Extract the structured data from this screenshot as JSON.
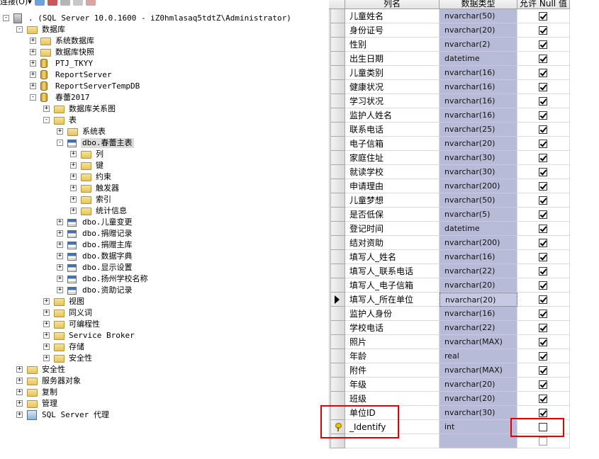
{
  "toolbar": {
    "connect_label": "连接(O)▾"
  },
  "tree": [
    {
      "level": 0,
      "expander": "-",
      "icon": "server",
      "label": ". (SQL Server 10.0.1600 - iZ0hmlasaq5tdtZ\\Administrator)"
    },
    {
      "level": 1,
      "expander": "-",
      "icon": "folder",
      "label": "数据库"
    },
    {
      "level": 2,
      "expander": "+",
      "icon": "folder",
      "label": "系统数据库"
    },
    {
      "level": 2,
      "expander": "+",
      "icon": "folder",
      "label": "数据库快照"
    },
    {
      "level": 2,
      "expander": "+",
      "icon": "db",
      "label": "PTJ_TKYY"
    },
    {
      "level": 2,
      "expander": "+",
      "icon": "db",
      "label": "ReportServer"
    },
    {
      "level": 2,
      "expander": "+",
      "icon": "db",
      "label": "ReportServerTempDB"
    },
    {
      "level": 2,
      "expander": "-",
      "icon": "db",
      "label": "春蕾2017"
    },
    {
      "level": 3,
      "expander": "+",
      "icon": "folder",
      "label": "数据库关系图"
    },
    {
      "level": 3,
      "expander": "-",
      "icon": "folder",
      "label": "表"
    },
    {
      "level": 4,
      "expander": "+",
      "icon": "folder",
      "label": "系统表"
    },
    {
      "level": 4,
      "expander": "-",
      "icon": "table",
      "label": "dbo.春蕾主表",
      "selected": true
    },
    {
      "level": 5,
      "expander": "+",
      "icon": "folder",
      "label": "列"
    },
    {
      "level": 5,
      "expander": "+",
      "icon": "folder",
      "label": "键"
    },
    {
      "level": 5,
      "expander": "+",
      "icon": "folder",
      "label": "约束"
    },
    {
      "level": 5,
      "expander": "+",
      "icon": "folder",
      "label": "触发器"
    },
    {
      "level": 5,
      "expander": "+",
      "icon": "folder",
      "label": "索引"
    },
    {
      "level": 5,
      "expander": "+",
      "icon": "folder",
      "label": "统计信息"
    },
    {
      "level": 4,
      "expander": "+",
      "icon": "table",
      "label": "dbo.儿童变更"
    },
    {
      "level": 4,
      "expander": "+",
      "icon": "table",
      "label": "dbo.捐赠记录"
    },
    {
      "level": 4,
      "expander": "+",
      "icon": "table",
      "label": "dbo.捐赠主库"
    },
    {
      "level": 4,
      "expander": "+",
      "icon": "table",
      "label": "dbo.数据字典"
    },
    {
      "level": 4,
      "expander": "+",
      "icon": "table",
      "label": "dbo.显示设置"
    },
    {
      "level": 4,
      "expander": "+",
      "icon": "table",
      "label": "dbo.扬州学校名称"
    },
    {
      "level": 4,
      "expander": "+",
      "icon": "table",
      "label": "dbo.资助记录"
    },
    {
      "level": 3,
      "expander": "+",
      "icon": "folder",
      "label": "视图"
    },
    {
      "level": 3,
      "expander": "+",
      "icon": "folder",
      "label": "同义词"
    },
    {
      "level": 3,
      "expander": "+",
      "icon": "folder",
      "label": "可编程性"
    },
    {
      "level": 3,
      "expander": "+",
      "icon": "folder",
      "label": "Service Broker"
    },
    {
      "level": 3,
      "expander": "+",
      "icon": "folder",
      "label": "存储"
    },
    {
      "level": 3,
      "expander": "+",
      "icon": "folder",
      "label": "安全性"
    },
    {
      "level": 1,
      "expander": "+",
      "icon": "folder",
      "label": "安全性"
    },
    {
      "level": 1,
      "expander": "+",
      "icon": "folder",
      "label": "服务器对象"
    },
    {
      "level": 1,
      "expander": "+",
      "icon": "folder",
      "label": "复制"
    },
    {
      "level": 1,
      "expander": "+",
      "icon": "folder",
      "label": "管理"
    },
    {
      "level": 1,
      "expander": "+",
      "icon": "agent",
      "label": "SQL Server 代理"
    }
  ],
  "designer": {
    "headers": {
      "name": "列名",
      "type": "数据类型",
      "nullable": "允许 Null 值"
    },
    "rows": [
      {
        "name": "儿童姓名",
        "type": "nvarchar(50)",
        "allow_null": true
      },
      {
        "name": "身份证号",
        "type": "nvarchar(20)",
        "allow_null": true
      },
      {
        "name": "性别",
        "type": "nvarchar(2)",
        "allow_null": true
      },
      {
        "name": "出生日期",
        "type": "datetime",
        "allow_null": true
      },
      {
        "name": "儿童类别",
        "type": "nvarchar(16)",
        "allow_null": true
      },
      {
        "name": "健康状况",
        "type": "nvarchar(16)",
        "allow_null": true
      },
      {
        "name": "学习状况",
        "type": "nvarchar(16)",
        "allow_null": true
      },
      {
        "name": "监护人姓名",
        "type": "nvarchar(16)",
        "allow_null": true
      },
      {
        "name": "联系电话",
        "type": "nvarchar(25)",
        "allow_null": true
      },
      {
        "name": "电子信箱",
        "type": "nvarchar(20)",
        "allow_null": true
      },
      {
        "name": "家庭住址",
        "type": "nvarchar(30)",
        "allow_null": true
      },
      {
        "name": "就读学校",
        "type": "nvarchar(30)",
        "allow_null": true
      },
      {
        "name": "申请理由",
        "type": "nvarchar(200)",
        "allow_null": true
      },
      {
        "name": "儿童梦想",
        "type": "nvarchar(50)",
        "allow_null": true
      },
      {
        "name": "是否低保",
        "type": "nvarchar(5)",
        "allow_null": true
      },
      {
        "name": "登记时间",
        "type": "datetime",
        "allow_null": true
      },
      {
        "name": "结对资助",
        "type": "nvarchar(200)",
        "allow_null": true
      },
      {
        "name": "填写人_姓名",
        "type": "nvarchar(16)",
        "allow_null": true
      },
      {
        "name": "填写人_联系电话",
        "type": "nvarchar(22)",
        "allow_null": true
      },
      {
        "name": "填写人_电子信箱",
        "type": "nvarchar(20)",
        "allow_null": true
      },
      {
        "name": "填写人_所在单位",
        "type": "nvarchar(20)",
        "allow_null": true,
        "current": true
      },
      {
        "name": "监护人身份",
        "type": "nvarchar(16)",
        "allow_null": true
      },
      {
        "name": "学校电话",
        "type": "nvarchar(22)",
        "allow_null": true
      },
      {
        "name": "照片",
        "type": "nvarchar(MAX)",
        "allow_null": true
      },
      {
        "name": "年龄",
        "type": "real",
        "allow_null": true
      },
      {
        "name": "附件",
        "type": "nvarchar(MAX)",
        "allow_null": true
      },
      {
        "name": "年级",
        "type": "nvarchar(20)",
        "allow_null": true
      },
      {
        "name": "班级",
        "type": "nvarchar(20)",
        "allow_null": true
      },
      {
        "name": "单位ID",
        "type": "nvarchar(30)",
        "allow_null": true
      },
      {
        "name": "_Identify",
        "type": "int",
        "allow_null": false,
        "primary_key": true
      },
      {
        "name": "",
        "type": "",
        "allow_null": false,
        "empty": true
      }
    ]
  },
  "colors": {
    "type_column_bg": "#b8bbd8",
    "highlight_box": "#e00000",
    "selection_bg": "#dcdcdc"
  }
}
